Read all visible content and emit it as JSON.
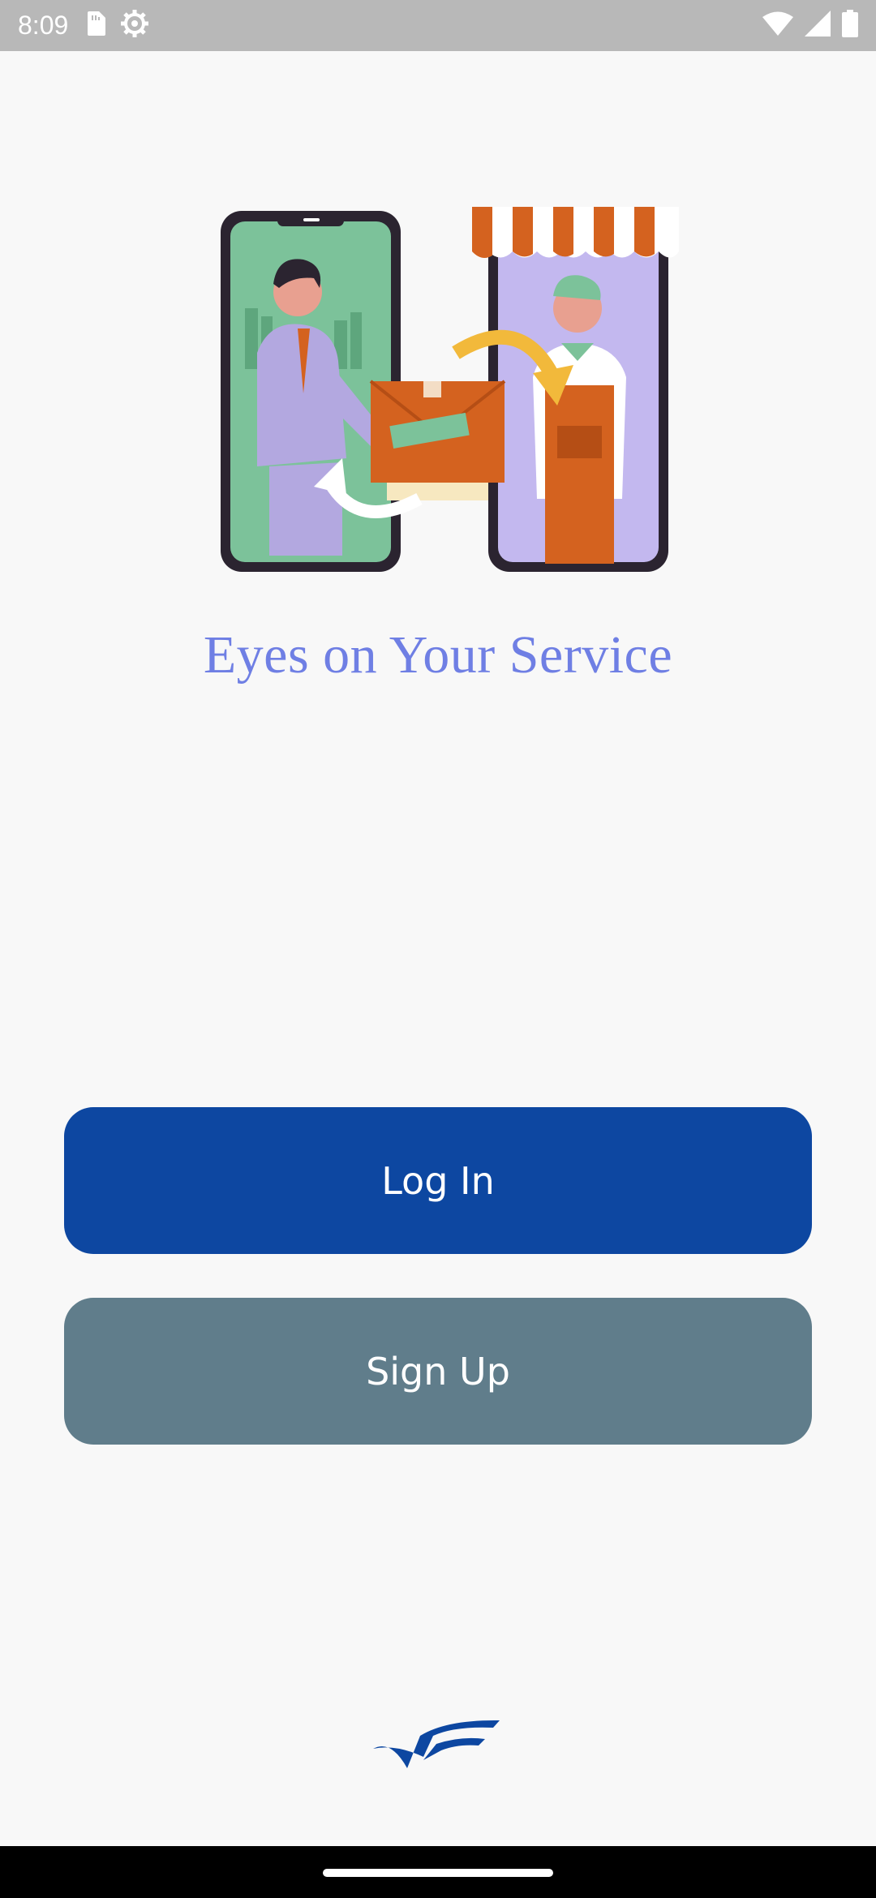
{
  "status_bar": {
    "time": "8:09",
    "left_icons": [
      "sim-card-icon",
      "settings-gear-icon"
    ],
    "right_icons": [
      "wifi-icon",
      "cell-signal-icon",
      "battery-icon"
    ]
  },
  "hero": {
    "illustration": "delivery-handoff-illustration"
  },
  "tagline": "Eyes on Your Service",
  "buttons": {
    "login_label": "Log In",
    "signup_label": "Sign Up"
  },
  "colors": {
    "primary": "#0d47a1",
    "secondary": "#607d8b",
    "tagline": "#6f7fe4",
    "background": "#f8f8f8"
  }
}
